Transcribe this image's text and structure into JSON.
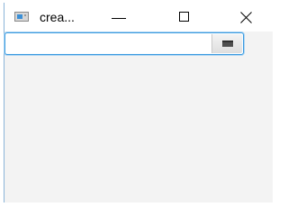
{
  "window": {
    "title": "crea...",
    "controls": {
      "minimize_icon": "minimize-icon",
      "maximize_icon": "maximize-icon",
      "close_icon": "close-icon"
    }
  },
  "date_picker": {
    "value": "",
    "placeholder": "",
    "button_icon": "calendar-icon",
    "focus_color": "#3d9ce0"
  }
}
